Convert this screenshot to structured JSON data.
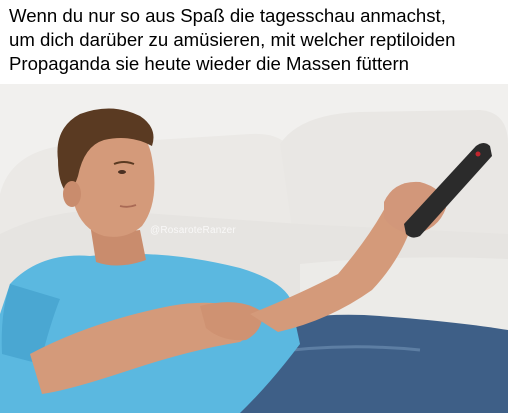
{
  "caption": {
    "lines": [
      "Wenn du nur so aus Spaß die tagesschau anmachst,",
      "um dich darüber zu amüsieren, mit welcher reptiloiden",
      "Propaganda sie heute wieder die Massen füttern"
    ]
  },
  "photo": {
    "watermark": "@RosaroteRanzer",
    "colors": {
      "wall": "#f1f0ee",
      "sofa": "#ebe9e6",
      "shirt": "#5bb8e0",
      "jeans": "#3e5f87",
      "skin": "#d49a7a",
      "hair": "#5a3a22",
      "remote": "#2b2b2b"
    }
  }
}
